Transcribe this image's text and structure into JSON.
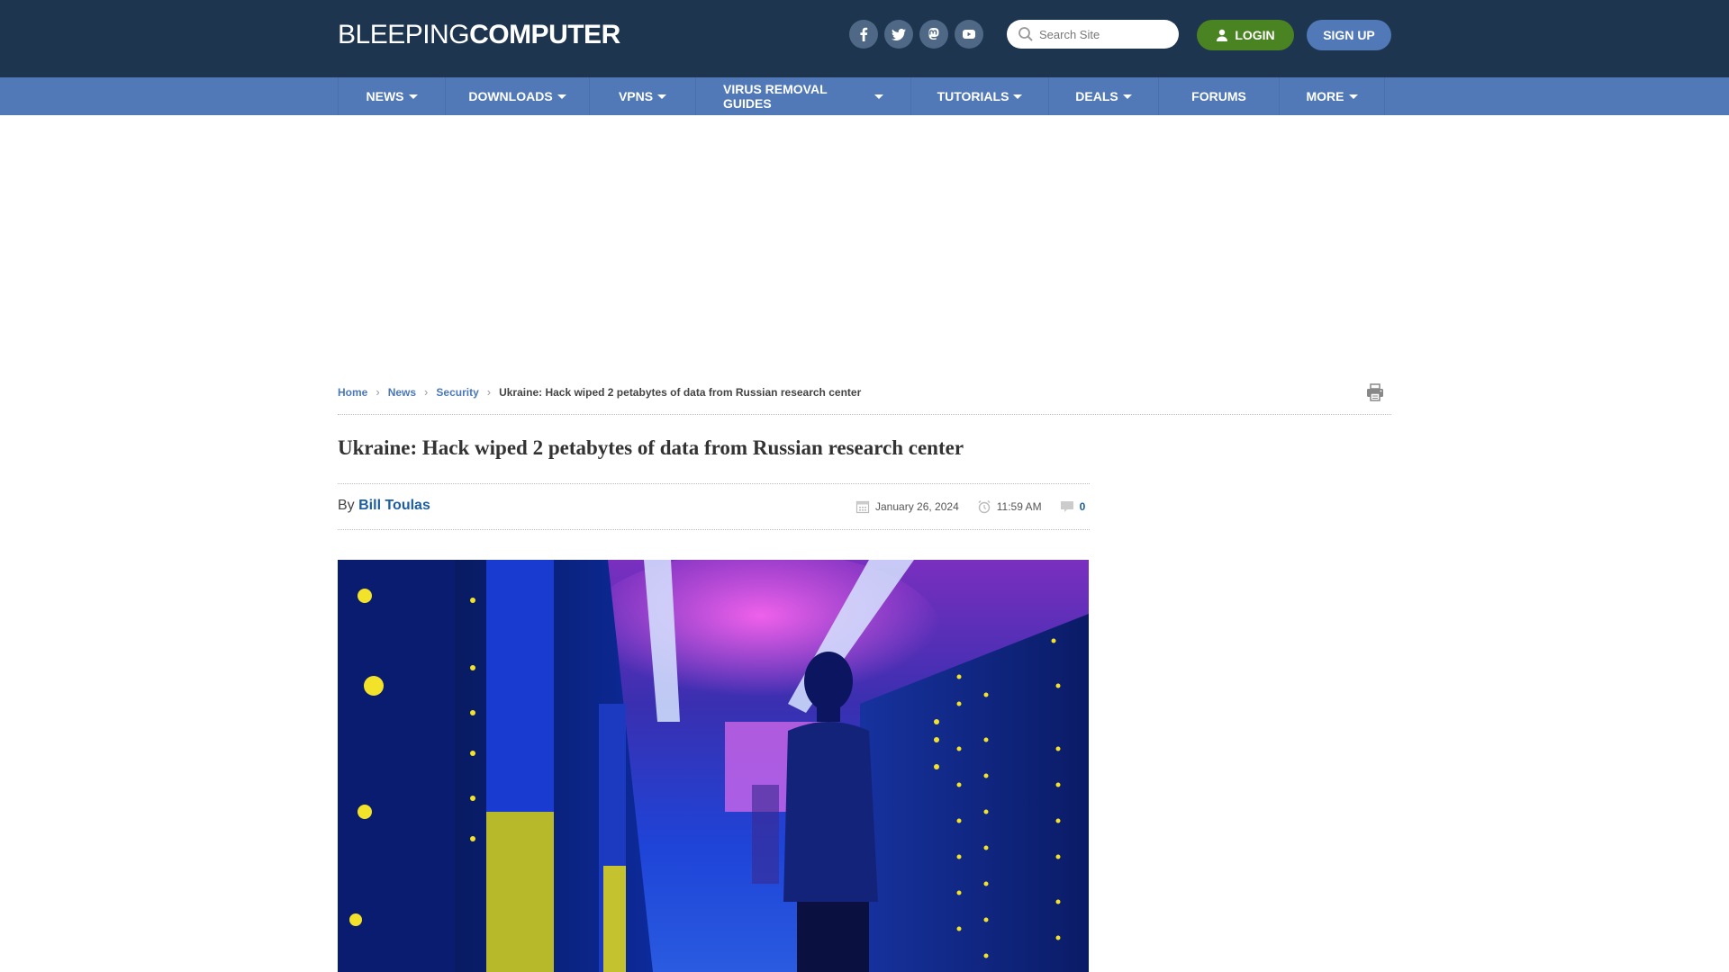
{
  "site": {
    "logo_light": "BLEEPING",
    "logo_bold": "COMPUTER"
  },
  "header": {
    "socials": [
      {
        "icon": "facebook-icon",
        "label": "Facebook"
      },
      {
        "icon": "twitter-icon",
        "label": "Twitter"
      },
      {
        "icon": "mastodon-icon",
        "label": "Mastodon"
      },
      {
        "icon": "youtube-icon",
        "label": "YouTube"
      }
    ],
    "search_placeholder": "Search Site",
    "login_label": "LOGIN",
    "signup_label": "SIGN UP"
  },
  "nav": {
    "items": [
      {
        "label": "NEWS",
        "dropdown": true
      },
      {
        "label": "DOWNLOADS",
        "dropdown": true
      },
      {
        "label": "VPNS",
        "dropdown": true
      },
      {
        "label": "VIRUS REMOVAL GUIDES",
        "dropdown": true
      },
      {
        "label": "TUTORIALS",
        "dropdown": true
      },
      {
        "label": "DEALS",
        "dropdown": true
      },
      {
        "label": "FORUMS",
        "dropdown": false
      },
      {
        "label": "MORE",
        "dropdown": true
      }
    ]
  },
  "breadcrumb": {
    "items": [
      "Home",
      "News",
      "Security"
    ],
    "current": "Ukraine: Hack wiped 2 petabytes of data from Russian research center"
  },
  "article": {
    "title": "Ukraine: Hack wiped 2 petabytes of data from Russian research center",
    "by_label": "By",
    "author": "Bill Toulas",
    "date": "January 26, 2024",
    "time": "11:59 AM",
    "comments_count": "0",
    "hero_image_alt": "Server room with Ukrainian flag and person walking down aisle"
  },
  "colors": {
    "header_bg": "#1e3550",
    "nav_bg": "#5179b8",
    "login_bg": "#4a8321",
    "signup_bg": "#5179b8",
    "link": "#4b78b9",
    "author_link": "#1b5ea1"
  }
}
